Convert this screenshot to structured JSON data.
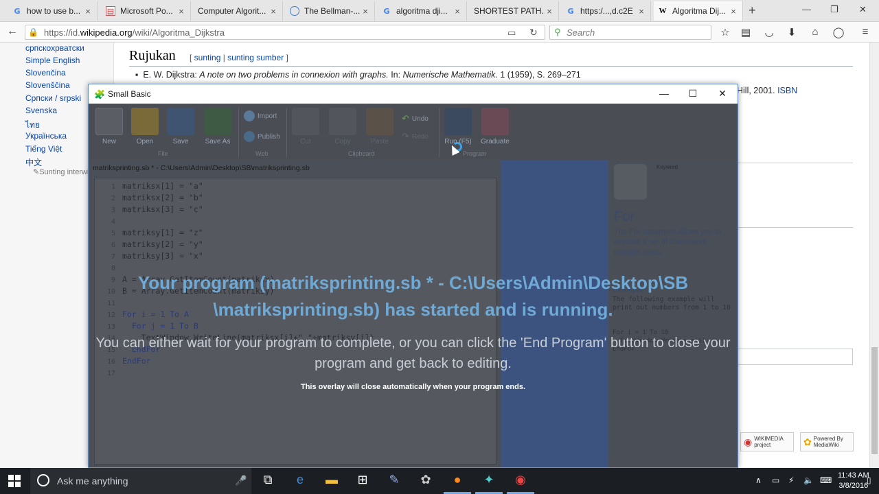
{
  "browser": {
    "tabs": [
      {
        "label": "how to use b...",
        "icon": "google-icon"
      },
      {
        "label": "Microsoft Po...",
        "icon": "webdoc-icon"
      },
      {
        "label": "Computer Algorit...",
        "icon": "webdoc-icon"
      },
      {
        "label": "The Bellman-...",
        "icon": "globe-icon"
      },
      {
        "label": "algoritma dji...",
        "icon": "google-icon"
      },
      {
        "label": "SHORTEST PATH...",
        "icon": "blank-icon"
      },
      {
        "label": "https:/...,d.c2E",
        "icon": "google-icon"
      },
      {
        "label": "Algoritma Dij...",
        "icon": "wikipedia-icon",
        "active": true
      }
    ],
    "url_prefix": "https://id.",
    "url_domain": "wikipedia.org",
    "url_path": "/wiki/Algoritma_Dijkstra",
    "search_placeholder": "Search"
  },
  "wiki": {
    "languages": [
      "српскохрватски",
      "Simple English",
      "Slovenčina",
      "Slovenščina",
      "Српски / srpski",
      "Svenska",
      "ไทย",
      "Українська",
      "Tiếng Việt",
      "中文"
    ],
    "edit_links": "Sunting interwiki",
    "ref_heading": "Rujukan",
    "ref_edit_open": "[ ",
    "ref_edit_1": "sunting",
    "ref_edit_sep": " | ",
    "ref_edit_2": "sunting sumber",
    "ref_edit_close": " ]",
    "ref_author": "E. W. Dijkstra: ",
    "ref_title": "A note on two problems in connexion with graphs.",
    "ref_in": " In: ",
    "ref_journal": "Numerische Mathematik.",
    "ref_rest": " 1 (1959), S. 269–271",
    "ref2_text": "Hill, 2001. ",
    "ref2_link": "ISBN",
    "wikimedia_label": "WIKIMEDIA project",
    "mediawiki_label": "Powered By MediaWiki"
  },
  "smallbasic": {
    "window_title": "Small Basic",
    "ribbon": {
      "new": "New",
      "open": "Open",
      "save": "Save",
      "save_as": "Save As",
      "import": "Import",
      "publish": "Publish",
      "cut": "Cut",
      "copy": "Copy",
      "paste": "Paste",
      "undo": "Undo",
      "redo": "Redo",
      "run": "Run (F5)",
      "graduate": "Graduate",
      "group_file": "File",
      "group_web": "Web",
      "group_clipboard": "Clipboard",
      "group_program": "Program"
    },
    "editor_title": "matriksprinting.sb * - C:\\Users\\Admin\\Desktop\\SB\\matriksprinting.sb",
    "code_lines": [
      {
        "n": "1",
        "t": "matriksx[1] = \"a\""
      },
      {
        "n": "2",
        "t": "matriksx[2] = \"b\""
      },
      {
        "n": "3",
        "t": "matriksx[3] = \"c\""
      },
      {
        "n": "4",
        "t": ""
      },
      {
        "n": "5",
        "t": "matriksy[1] = \"z\""
      },
      {
        "n": "6",
        "t": "matriksy[2] = \"y\""
      },
      {
        "n": "7",
        "t": "matriksy[3] = \"x\""
      },
      {
        "n": "8",
        "t": ""
      },
      {
        "n": "9",
        "t": "A = Array.GetItemCount(matriksx)"
      },
      {
        "n": "10",
        "t": "B = Array.GetItemCount(matriksy)"
      },
      {
        "n": "11",
        "t": ""
      },
      {
        "n": "12",
        "t": "For i = 1 To A"
      },
      {
        "n": "13",
        "t": "  For j = 1 To B"
      },
      {
        "n": "14",
        "t": "    TextWindow.WriteLine(matriksx[i]+\" \"+matriksy[j])"
      },
      {
        "n": "15",
        "t": "  EndFor"
      },
      {
        "n": "16",
        "t": "EndFor"
      },
      {
        "n": "17",
        "t": ""
      }
    ],
    "help": {
      "keyword_label": "Keyword",
      "title": "For",
      "description": "The For statement allows you to execute a set of statements multiple times.",
      "example_heading": "Example",
      "example_text": "The following example will print out numbers from 1 to 10",
      "example_code": "For i = 1 To 10\n  TextWindow.WriteLine(i)\nEndFor"
    },
    "overlay_main": "Your program (matriksprinting.sb * - C:\\Users\\Admin\\Desktop\\SB \\matriksprinting.sb) has started and is running.",
    "overlay_sub": "You can either wait for your program to complete, or you can click the 'End Program' button to close your program and get back to editing.",
    "overlay_note": "This overlay will close automatically when your program ends."
  },
  "taskbar": {
    "search_placeholder": "Ask me anything",
    "time": "11:43 AM",
    "date": "3/8/2016"
  },
  "colors": {
    "overlay_title": "#6fa9d6",
    "taskbar": "#1b1f24",
    "link": "#0645ad"
  }
}
